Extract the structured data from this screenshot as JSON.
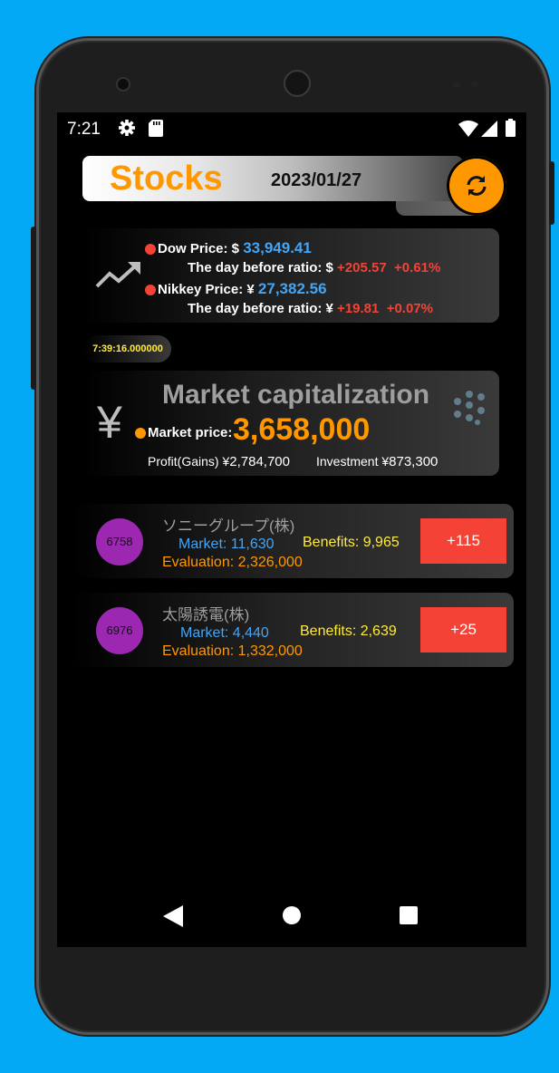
{
  "status_bar": {
    "time": "7:21"
  },
  "header": {
    "title": "Stocks",
    "date": "2023/01/27"
  },
  "indices": {
    "dow_label": "Dow Price: $",
    "dow_value": "33,949.41",
    "dow_ratio_label": "The day before ratio: $",
    "dow_change": "+205.57",
    "dow_pct": "+0.61%",
    "nikkei_label": "Nikkey Price: ¥",
    "nikkei_value": "27,382.56",
    "nikkei_ratio_label": "The day before ratio: ¥",
    "nikkei_change": "+19.81",
    "nikkei_pct": "+0.07%"
  },
  "update_time": "7:39:16.000000",
  "market_cap": {
    "title": "Market capitalization",
    "currency": "¥",
    "price_label": "Market price:",
    "price": "3,658,000",
    "profit_label": "Profit(Gains) ¥",
    "profit": "2,784,700",
    "investment_label": "Investment ¥",
    "investment": "873,300"
  },
  "stocks": [
    {
      "code": "6758",
      "name": "ソニーグループ(株)",
      "market": "Market: 11,630",
      "benefits": "Benefits: 9,965",
      "evaluation": "Evaluation: 2,326,000",
      "delta": "+115"
    },
    {
      "code": "6976",
      "name": "太陽誘電(株)",
      "market": "Market: 4,440",
      "benefits": "Benefits: 2,639",
      "evaluation": "Evaluation: 1,332,000",
      "delta": "+25"
    }
  ],
  "colors": {
    "accent": "#ff9800",
    "positive": "#f44336",
    "price_blue": "#42a5f5",
    "badge": "#9c27b0",
    "benefits": "#ffeb3b"
  }
}
